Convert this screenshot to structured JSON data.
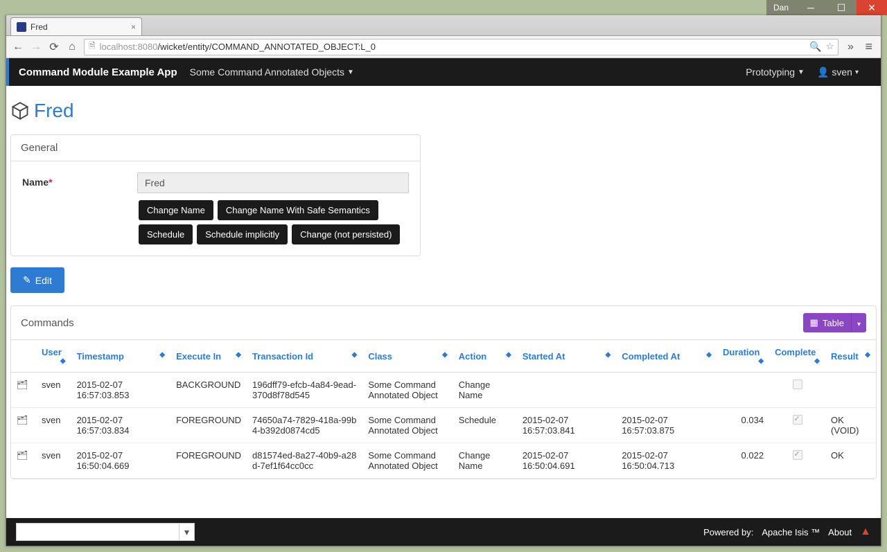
{
  "window": {
    "user": "Dan"
  },
  "browser": {
    "tab_title": "Fred",
    "url_host": "localhost",
    "url_port": ":8080",
    "url_path": "/wicket/entity/COMMAND_ANNOTATED_OBJECT:L_0"
  },
  "navbar": {
    "brand": "Command Module Example App",
    "menu1": "Some Command Annotated Objects",
    "right_menu": "Prototyping",
    "user": "sven"
  },
  "entity": {
    "title": "Fred"
  },
  "general": {
    "panel_title": "General",
    "name_label": "Name",
    "name_value": "Fred",
    "buttons": {
      "change_name": "Change Name",
      "change_name_safe": "Change Name With Safe Semantics",
      "schedule": "Schedule",
      "schedule_implicitly": "Schedule implicitly",
      "change_not_persisted": "Change (not persisted)"
    }
  },
  "edit_label": "Edit",
  "commands": {
    "panel_title": "Commands",
    "table_button": "Table",
    "headers": {
      "user": "User",
      "timestamp": "Timestamp",
      "execute_in": "Execute In",
      "transaction_id": "Transaction Id",
      "class": "Class",
      "action": "Action",
      "started_at": "Started At",
      "completed_at": "Completed At",
      "duration": "Duration",
      "complete": "Complete",
      "result": "Result"
    },
    "rows": [
      {
        "user": "sven",
        "timestamp": "2015-02-07 16:57:03.853",
        "execute_in": "BACKGROUND",
        "transaction_id": "196dff79-efcb-4a84-9ead-370d8f78d545",
        "class": "Some Command Annotated Object",
        "action": "Change Name",
        "started_at": "",
        "completed_at": "",
        "duration": "",
        "complete": false,
        "result": ""
      },
      {
        "user": "sven",
        "timestamp": "2015-02-07 16:57:03.834",
        "execute_in": "FOREGROUND",
        "transaction_id": "74650a74-7829-418a-99b4-b392d0874cd5",
        "class": "Some Command Annotated Object",
        "action": "Schedule",
        "started_at": "2015-02-07 16:57:03.841",
        "completed_at": "2015-02-07 16:57:03.875",
        "duration": "0.034",
        "complete": true,
        "result": "OK (VOID)"
      },
      {
        "user": "sven",
        "timestamp": "2015-02-07 16:50:04.669",
        "execute_in": "FOREGROUND",
        "transaction_id": "d81574ed-8a27-40b9-a28d-7ef1f64cc0cc",
        "class": "Some Command Annotated Object",
        "action": "Change Name",
        "started_at": "2015-02-07 16:50:04.691",
        "completed_at": "2015-02-07 16:50:04.713",
        "duration": "0.022",
        "complete": true,
        "result": "OK"
      }
    ]
  },
  "footer": {
    "powered_by": "Powered by:",
    "apache_isis": "Apache Isis ™",
    "about": "About"
  }
}
